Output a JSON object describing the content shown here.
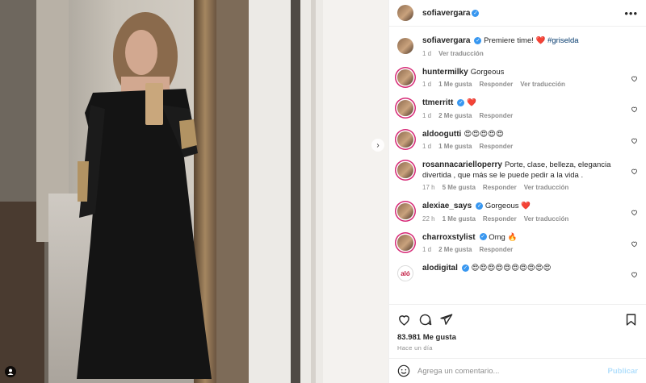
{
  "post": {
    "username": "sofiavergara",
    "caption": "Premiere time! ❤️ #griselda",
    "caption_time": "1 d",
    "caption_translate": "Ver traducción"
  },
  "comments": [
    {
      "username": "huntermilky",
      "verified": false,
      "text": "Gorgeous",
      "time": "1 d",
      "likes": "1 Me gusta",
      "reply": "Responder",
      "translate": "Ver traducción"
    },
    {
      "username": "ttmerritt",
      "verified": true,
      "text": "❤️",
      "time": "1 d",
      "likes": "2 Me gusta",
      "reply": "Responder",
      "translate": ""
    },
    {
      "username": "aldoogutti",
      "verified": false,
      "text": "😍😍😍😍😍",
      "time": "1 d",
      "likes": "1 Me gusta",
      "reply": "Responder",
      "translate": ""
    },
    {
      "username": "rosannacarielloperry",
      "verified": false,
      "text": "Porte, clase, belleza, elegancia divertida , que más se le puede pedir a la vida .",
      "time": "17 h",
      "likes": "5 Me gusta",
      "reply": "Responder",
      "translate": "Ver traducción"
    },
    {
      "username": "alexiae_says",
      "verified": true,
      "text": "Gorgeous ❤️",
      "time": "22 h",
      "likes": "1 Me gusta",
      "reply": "Responder",
      "translate": "Ver traducción"
    },
    {
      "username": "charroxstylist",
      "verified": true,
      "text": "Omg 🔥",
      "time": "1 d",
      "likes": "2 Me gusta",
      "reply": "Responder",
      "translate": ""
    },
    {
      "username": "alodigital",
      "verified": true,
      "text": "😍😍😍😍😍😍😍😍😍😍",
      "time": "",
      "likes": "",
      "reply": "",
      "translate": ""
    }
  ],
  "footer": {
    "likes": "83.981 Me gusta",
    "time_ago": "Hace un día",
    "comment_placeholder": "Agrega un comentario...",
    "publish": "Publicar"
  },
  "colors": {
    "verified": "#3897f0",
    "link": "#00376b",
    "publish_disabled": "#b2dffc"
  },
  "icons": [
    "heart-icon",
    "comment-icon",
    "share-icon",
    "bookmark-icon",
    "emoji-icon",
    "more-options-icon",
    "chevron-right-icon",
    "tag-user-icon"
  ]
}
